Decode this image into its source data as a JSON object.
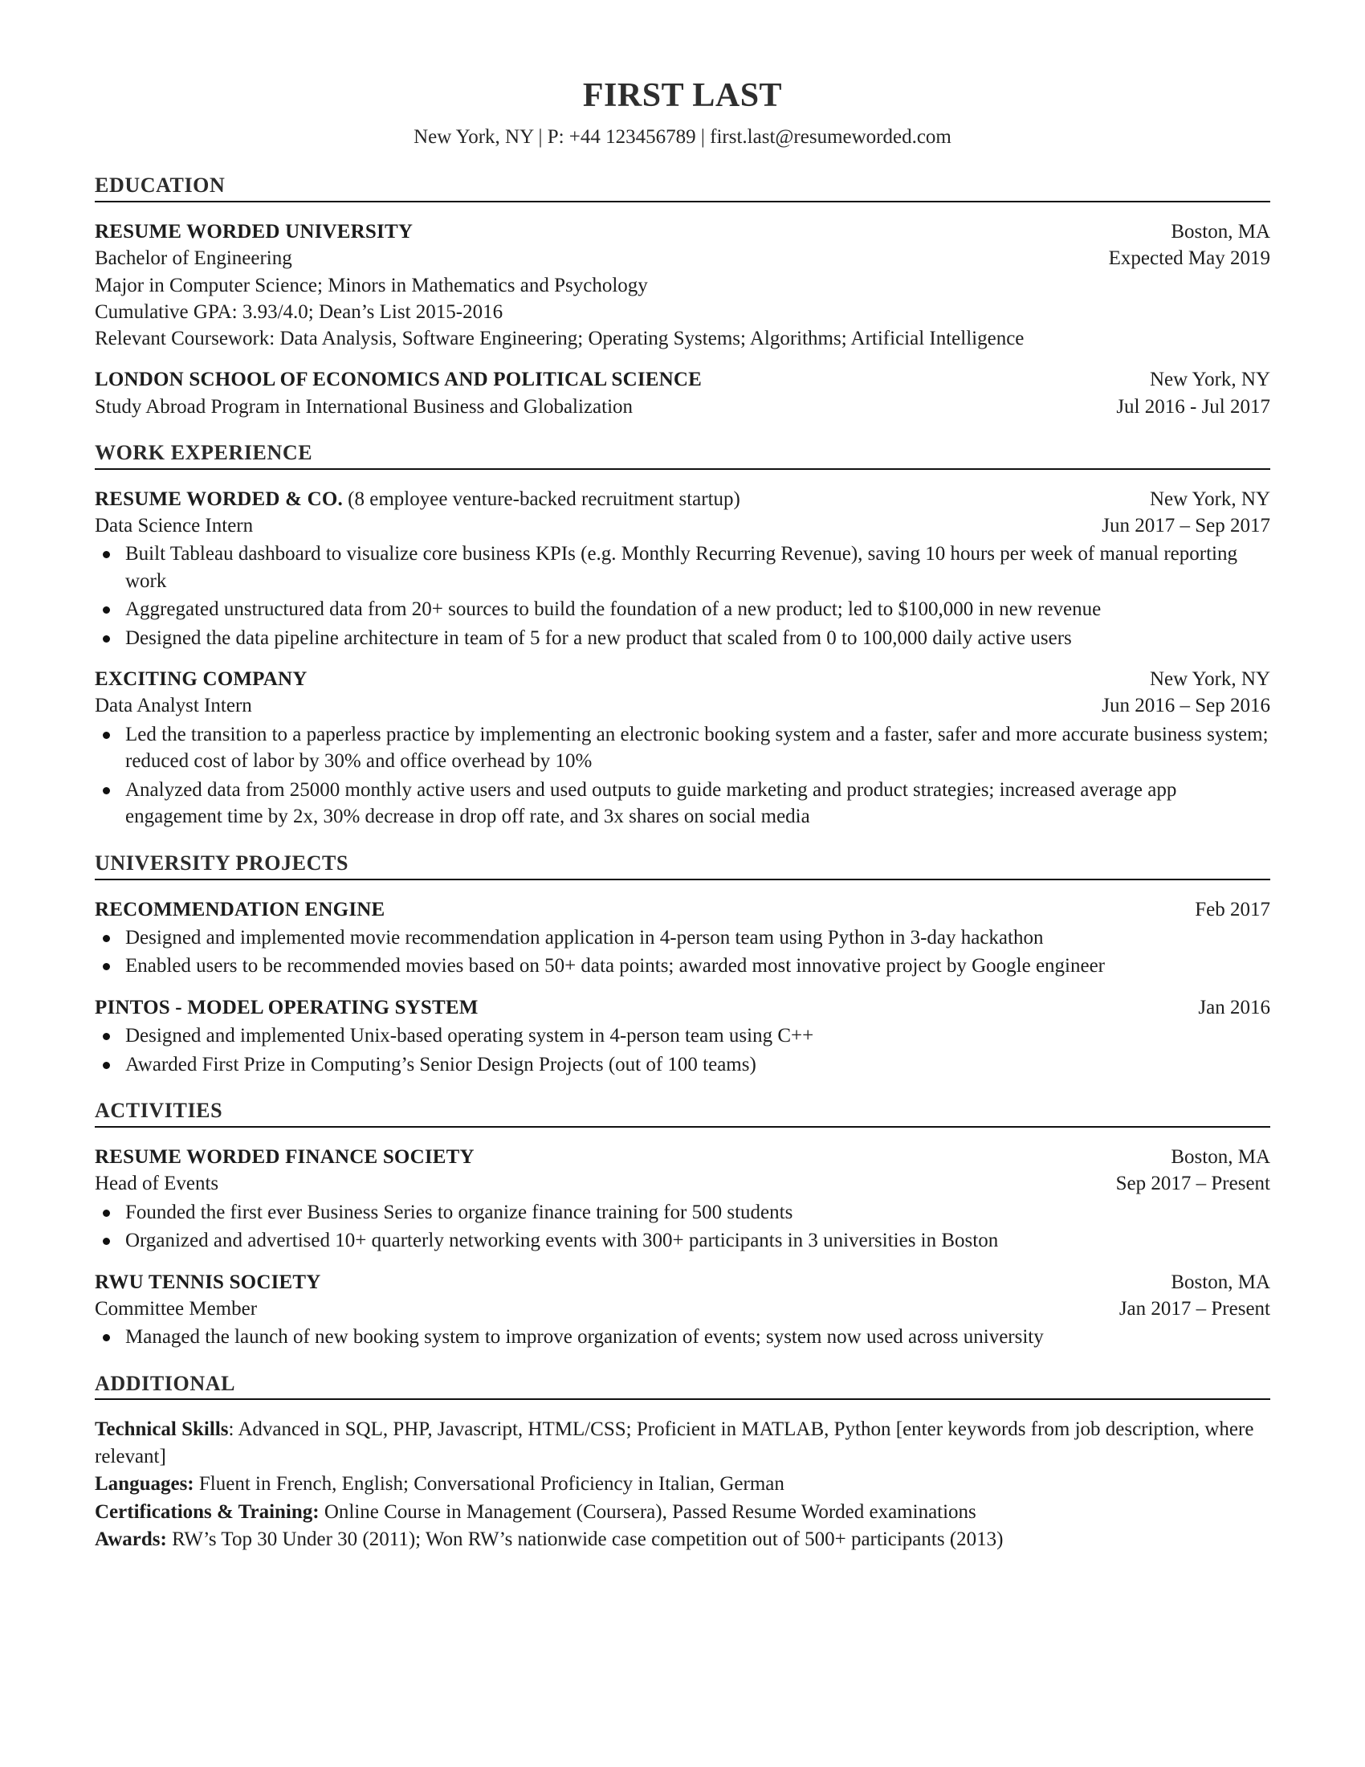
{
  "header": {
    "name": "FIRST LAST",
    "contact": "New York, NY | P: +44 123456789 | first.last@resumeworded.com"
  },
  "sections": {
    "education": {
      "title": "EDUCATION",
      "entries": [
        {
          "org": "RESUME WORDED UNIVERSITY",
          "location": "Boston, MA",
          "subtitle": "Bachelor of Engineering",
          "date": "Expected May 2019",
          "details": [
            "Major in Computer Science; Minors in Mathematics and Psychology",
            "Cumulative GPA: 3.93/4.0; Dean’s List 2015-2016",
            "Relevant Coursework: Data Analysis, Software Engineering; Operating Systems; Algorithms; Artificial Intelligence"
          ]
        },
        {
          "org": "LONDON SCHOOL OF ECONOMICS AND POLITICAL SCIENCE",
          "location": "New York, NY",
          "subtitle": "Study Abroad Program in International Business and Globalization",
          "date": "Jul 2016 - Jul 2017",
          "details": []
        }
      ]
    },
    "work": {
      "title": "WORK EXPERIENCE",
      "entries": [
        {
          "org": "RESUME WORDED & CO.",
          "org_note": "(8 employee venture-backed recruitment startup)",
          "location": "New York, NY",
          "subtitle": "Data Science Intern",
          "date": "Jun 2017 – Sep 2017",
          "bullets": [
            "Built Tableau dashboard to visualize core business KPIs (e.g. Monthly Recurring Revenue), saving 10 hours per week of manual reporting work",
            "Aggregated unstructured data from 20+ sources to build the foundation of a new product; led to $100,000 in new revenue",
            "Designed the data pipeline architecture in team of 5 for a new product that scaled from 0 to 100,000 daily active users"
          ]
        },
        {
          "org": "EXCITING COMPANY",
          "org_note": "",
          "location": "New York, NY",
          "subtitle": "Data Analyst Intern",
          "date": "Jun 2016 – Sep 2016",
          "bullets": [
            "Led the transition to a paperless practice by implementing an electronic booking system and a faster, safer and more accurate business system; reduced cost of labor by 30% and office overhead by 10%",
            "Analyzed data from 25000 monthly active users and used outputs to guide marketing and product strategies; increased average app engagement time by 2x, 30% decrease in drop off rate, and 3x shares on social media"
          ]
        }
      ]
    },
    "projects": {
      "title": "UNIVERSITY PROJECTS",
      "entries": [
        {
          "org": "RECOMMENDATION ENGINE",
          "date": "Feb 2017",
          "bullets": [
            "Designed and implemented movie recommendation application in 4-person team using Python in 3-day hackathon",
            "Enabled users to be recommended movies based on 50+ data points; awarded most innovative project by Google engineer"
          ]
        },
        {
          "org": "PINTOS - MODEL OPERATING SYSTEM",
          "date": "Jan 2016",
          "bullets": [
            "Designed and implemented Unix-based operating system in 4-person team using C++",
            "Awarded First Prize in Computing’s Senior Design Projects (out of 100 teams)"
          ]
        }
      ]
    },
    "activities": {
      "title": "ACTIVITIES",
      "entries": [
        {
          "org": "RESUME WORDED FINANCE SOCIETY",
          "location": "Boston, MA",
          "subtitle": "Head of Events",
          "date": "Sep 2017 – Present",
          "bullets": [
            "Founded the first ever Business Series to organize finance training for 500 students",
            "Organized and advertised 10+ quarterly networking events with 300+ participants in 3 universities in Boston"
          ]
        },
        {
          "org": "RWU TENNIS SOCIETY",
          "location": "Boston, MA",
          "subtitle": "Committee Member",
          "date": "Jan 2017 – Present",
          "bullets": [
            "Managed the launch of new booking system to improve organization of events; system now used across university"
          ]
        }
      ]
    },
    "additional": {
      "title": "ADDITIONAL",
      "lines": [
        {
          "label": "Technical Skills",
          "separator": ": ",
          "text": "Advanced in SQL, PHP, Javascript, HTML/CSS; Proficient in MATLAB, Python [enter keywords from job description, where relevant]"
        },
        {
          "label": "Languages:",
          "separator": " ",
          "text": "Fluent in French, English; Conversational Proficiency in Italian, German"
        },
        {
          "label": "Certifications & Training:",
          "separator": " ",
          "text": "Online Course in Management (Coursera), Passed Resume Worded examinations"
        },
        {
          "label": "Awards:",
          "separator": " ",
          "text": "RW’s Top 30 Under 30 (2011); Won RW’s nationwide case competition out of 500+ participants (2013)"
        }
      ]
    }
  }
}
